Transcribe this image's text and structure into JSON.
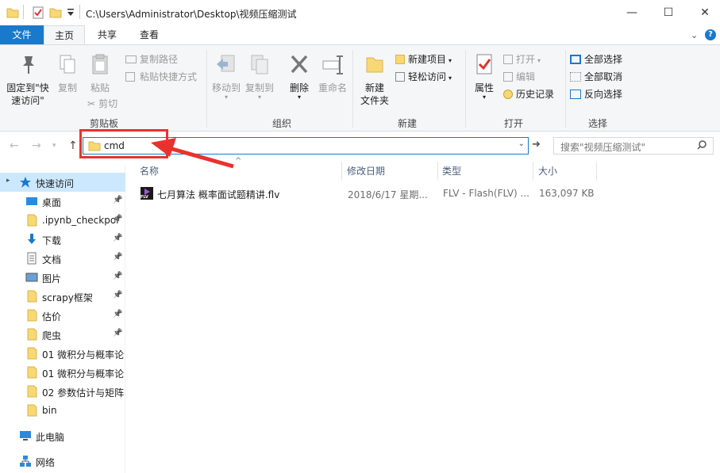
{
  "window": {
    "title": "C:\\Users\\Administrator\\Desktop\\视频压缩测试",
    "min_glyph": "—",
    "max_glyph": "☐",
    "close_glyph": "✕"
  },
  "tabs": {
    "file": "文件",
    "home": "主页",
    "share": "共享",
    "view": "查看"
  },
  "ribbon": {
    "clipboard": {
      "pin_line1": "固定到\"快",
      "pin_line2": "速访问\"",
      "copy": "复制",
      "paste": "粘贴",
      "copy_path": "复制路径",
      "paste_shortcut": "粘贴快捷方式",
      "cut": "剪切",
      "group": "剪贴板"
    },
    "organize": {
      "move_to": "移动到",
      "copy_to": "复制到",
      "delete": "删除",
      "rename": "重命名",
      "group": "组织"
    },
    "new": {
      "new_folder_line1": "新建",
      "new_folder_line2": "文件夹",
      "new_item": "新建项目",
      "easy_access": "轻松访问",
      "group": "新建"
    },
    "open": {
      "properties": "属性",
      "open": "打开",
      "edit": "编辑",
      "history": "历史记录",
      "group": "打开"
    },
    "select": {
      "select_all": "全部选择",
      "select_none": "全部取消",
      "invert": "反向选择",
      "group": "选择"
    }
  },
  "address": {
    "path": "cmd",
    "search_placeholder": "搜索\"视频压缩测试\""
  },
  "nav": {
    "items": [
      {
        "label": "快速访问",
        "icon": "star-icon",
        "pinned": false
      },
      {
        "label": "桌面",
        "icon": "desktop-icon",
        "pinned": true
      },
      {
        "label": ".ipynb_checkpoi",
        "icon": "folder-icon",
        "pinned": true
      },
      {
        "label": "下载",
        "icon": "download-icon",
        "pinned": true
      },
      {
        "label": "文档",
        "icon": "document-icon",
        "pinned": true
      },
      {
        "label": "图片",
        "icon": "picture-icon",
        "pinned": true
      },
      {
        "label": "scrapy框架",
        "icon": "folder-icon",
        "pinned": true
      },
      {
        "label": "估价",
        "icon": "folder-icon",
        "pinned": true
      },
      {
        "label": "爬虫",
        "icon": "folder-icon",
        "pinned": true
      },
      {
        "label": "01 微积分与概率论",
        "icon": "folder-icon",
        "pinned": false
      },
      {
        "label": "01 微积分与概率论",
        "icon": "folder-icon",
        "pinned": false
      },
      {
        "label": "02 参数估计与矩阵",
        "icon": "folder-icon",
        "pinned": false
      },
      {
        "label": "bin",
        "icon": "folder-icon",
        "pinned": false
      },
      {
        "label": "此电脑",
        "icon": "computer-icon",
        "pinned": false
      },
      {
        "label": "网络",
        "icon": "network-icon",
        "pinned": false
      }
    ]
  },
  "columns": {
    "name": "名称",
    "modified": "修改日期",
    "type": "类型",
    "size": "大小"
  },
  "files": [
    {
      "name": "七月算法 概率面试题精讲.flv",
      "modified": "2018/6/17 星期...",
      "type": "FLV - Flash(FLV) ...",
      "size": "163,097 KB",
      "badge": "FLV"
    }
  ],
  "colors": {
    "accent": "#1979ca",
    "annotation": "#e8322f",
    "selection": "#cce8ff",
    "folder": "#f8d775"
  }
}
